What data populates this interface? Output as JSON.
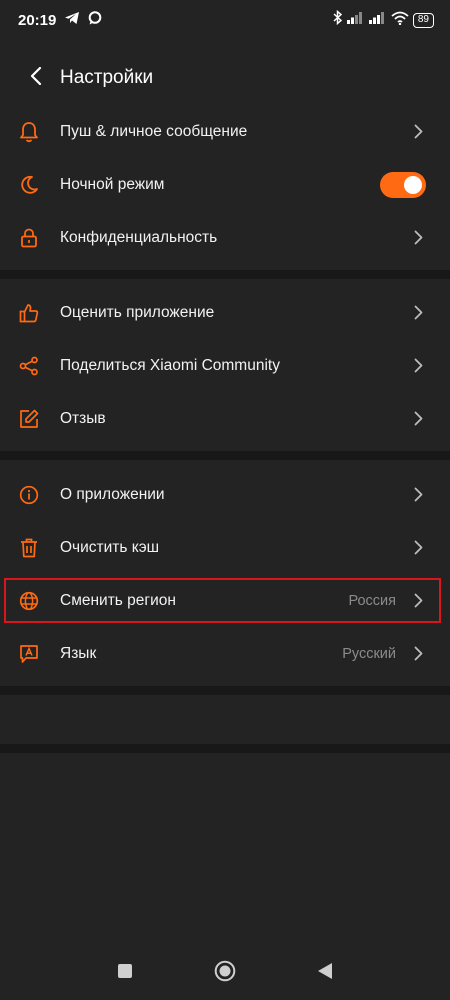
{
  "status_bar": {
    "time": "20:19",
    "battery": "89"
  },
  "header": {
    "title": "Настройки"
  },
  "groups": [
    {
      "items": [
        {
          "label": "Пуш & личное сообщение",
          "icon": "bell-icon",
          "type": "chevron"
        },
        {
          "label": "Ночной режим",
          "icon": "moon-icon",
          "type": "toggle",
          "toggle_on": true
        },
        {
          "label": "Конфиденциальность",
          "icon": "lock-icon",
          "type": "chevron"
        }
      ]
    },
    {
      "items": [
        {
          "label": "Оценить приложение",
          "icon": "thumbs-up-icon",
          "type": "chevron"
        },
        {
          "label": "Поделиться Xiaomi Community",
          "icon": "share-icon",
          "type": "chevron"
        },
        {
          "label": "Отзыв",
          "icon": "edit-icon",
          "type": "chevron"
        }
      ]
    },
    {
      "items": [
        {
          "label": "О приложении",
          "icon": "info-icon",
          "type": "chevron"
        },
        {
          "label": "Очистить кэш",
          "icon": "trash-icon",
          "type": "chevron"
        },
        {
          "label": "Сменить регион",
          "icon": "globe-icon",
          "type": "chevron",
          "value": "Россия"
        },
        {
          "label": "Язык",
          "icon": "language-icon",
          "type": "chevron",
          "value": "Русский"
        }
      ]
    }
  ],
  "colors": {
    "accent": "#ff6a13",
    "background": "#232323",
    "separator": "#181818",
    "highlight": "#d9161c"
  }
}
